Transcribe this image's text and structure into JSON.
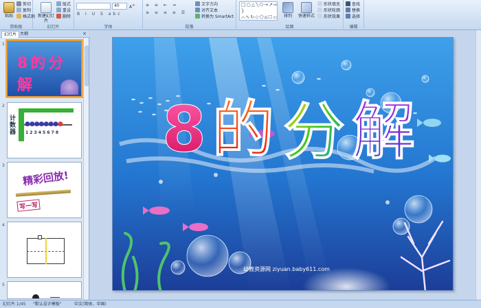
{
  "ribbon": {
    "clipboard": {
      "paste": "粘贴",
      "cut": "剪切",
      "copy": "复制",
      "format_painter": "格式刷",
      "label": "剪贴板"
    },
    "slides": {
      "new_slide": "新建幻灯片",
      "layout": "版式",
      "reset": "重设",
      "delete": "删除",
      "label": "幻灯片"
    },
    "font": {
      "font_name": "",
      "font_size": "40",
      "label": "字体"
    },
    "paragraph": {
      "text_direction": "文字方向",
      "align_text": "对齐文本",
      "smartart": "转换为 SmartArt",
      "label": "段落"
    },
    "drawing": {
      "arrange": "排列",
      "quick_styles": "快速样式",
      "shape_fill": "形状填充",
      "shape_outline": "形状轮廓",
      "shape_effects": "形状效果",
      "label": "绘图"
    },
    "editing": {
      "find": "查找",
      "replace": "替换",
      "select": "选择",
      "label": "编辑"
    }
  },
  "panel": {
    "tab_slides": "幻灯片",
    "tab_outline": "大纲",
    "close": "×",
    "thumbs": [
      {
        "num": "1",
        "title": "8的分解"
      },
      {
        "num": "2",
        "label": "计数器",
        "digits": "1 2 3 4 5 6 7 8"
      },
      {
        "num": "3",
        "title": "精彩回放!",
        "sub": "写一写"
      },
      {
        "num": "4"
      },
      {
        "num": "5"
      }
    ]
  },
  "slide": {
    "title_chars": [
      "8",
      "的",
      "分",
      "解"
    ],
    "watermark": "幼教资源网 ziyuan.baby611.com"
  },
  "status": {
    "slide_info": "幻灯片 1/45",
    "theme": "\"默认设计模板\"",
    "language": "中文(简体，中国)"
  },
  "colors": {
    "char1": "#e8176f",
    "char2": "#ff3d16",
    "char3": "#34c21d",
    "char4": "#9b22d6"
  }
}
